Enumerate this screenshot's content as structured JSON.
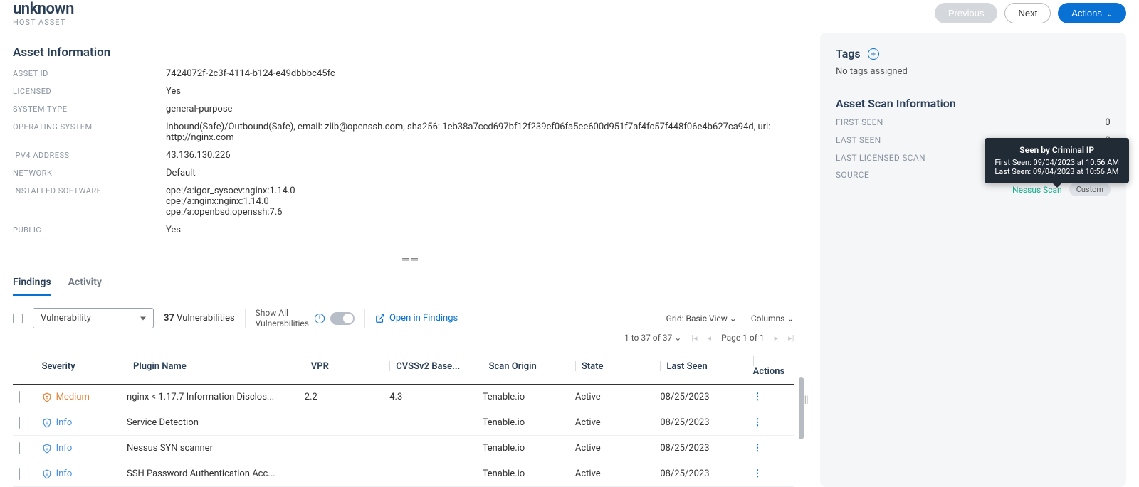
{
  "header": {
    "title": "unknown",
    "subtitle": "HOST ASSET",
    "previous": "Previous",
    "next": "Next",
    "actions": "Actions"
  },
  "asset_info": {
    "title": "Asset Information",
    "rows": [
      {
        "label": "ASSET ID",
        "value": "7424072f-2c3f-4114-b124-e49dbbbc45fc"
      },
      {
        "label": "LICENSED",
        "value": "Yes"
      },
      {
        "label": "SYSTEM TYPE",
        "value": "general-purpose"
      },
      {
        "label": "OPERATING SYSTEM",
        "value": "Inbound(Safe)/Outbound(Safe), email: zlib@openssh.com, sha256: 1eb38a7ccd697bf12f239ef06fa5ee600d951f7af4fc57f448f06e4b627ca94d, url: http://nginx.com"
      },
      {
        "label": "IPV4 ADDRESS",
        "value": "43.136.130.226"
      },
      {
        "label": "NETWORK",
        "value": "Default"
      },
      {
        "label": "INSTALLED SOFTWARE",
        "value": "cpe:/a:igor_sysoev:nginx:1.14.0\ncpe:/a:nginx:nginx:1.14.0\ncpe:/a:openbsd:openssh:7.6"
      },
      {
        "label": "PUBLIC",
        "value": "Yes"
      }
    ]
  },
  "tabs": {
    "findings": "Findings",
    "activity": "Activity"
  },
  "toolbar": {
    "filter": "Vulnerability",
    "count_num": "37",
    "count_label": " Vulnerabilities",
    "show_all": "Show All\nVulnerabilities",
    "open": "Open in Findings",
    "grid": "Grid: Basic View",
    "columns": "Columns",
    "range": "1 to 37 of 37",
    "page": "Page 1 of 1"
  },
  "table": {
    "headers": {
      "severity": "Severity",
      "plugin": "Plugin Name",
      "vpr": "VPR",
      "cvss": "CVSSv2 Base...",
      "origin": "Scan Origin",
      "state": "State",
      "last": "Last Seen",
      "actions": "Actions"
    },
    "rows": [
      {
        "severity": "Medium",
        "sev_class": "medium",
        "plugin": "nginx < 1.17.7 Information Disclos...",
        "vpr": "2.2",
        "cvss": "4.3",
        "origin": "Tenable.io",
        "state": "Active",
        "last": "08/25/2023"
      },
      {
        "severity": "Info",
        "sev_class": "info",
        "plugin": "Service Detection",
        "vpr": "",
        "cvss": "",
        "origin": "Tenable.io",
        "state": "Active",
        "last": "08/25/2023"
      },
      {
        "severity": "Info",
        "sev_class": "info",
        "plugin": "Nessus SYN scanner",
        "vpr": "",
        "cvss": "",
        "origin": "Tenable.io",
        "state": "Active",
        "last": "08/25/2023"
      },
      {
        "severity": "Info",
        "sev_class": "info",
        "plugin": "SSH Password Authentication Acc...",
        "vpr": "",
        "cvss": "",
        "origin": "Tenable.io",
        "state": "Active",
        "last": "08/25/2023"
      }
    ]
  },
  "sidebar": {
    "tags_title": "Tags",
    "no_tags": "No tags assigned",
    "scan_title": "Asset Scan Information",
    "rows": [
      {
        "label": "FIRST SEEN",
        "value": "0"
      },
      {
        "label": "LAST SEEN",
        "value": "0"
      },
      {
        "label": "LAST LICENSED SCAN",
        "value": ""
      },
      {
        "label": "SOURCE",
        "value": ""
      }
    ],
    "source_link": "Nessus Scan",
    "source_badge": "Custom",
    "tooltip": {
      "title": "Seen by Criminal IP",
      "line1": "First Seen: 09/04/2023 at 10:56 AM",
      "line2": "Last Seen: 09/04/2023 at 10:56 AM"
    }
  }
}
